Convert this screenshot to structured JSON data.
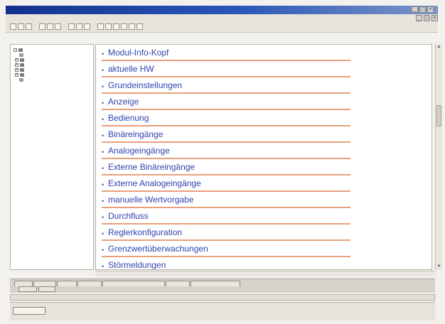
{
  "window": {
    "title": "",
    "controls": [
      "_",
      "□",
      "×"
    ]
  },
  "menu": {
    "items": [
      "",
      "",
      "",
      "",
      ""
    ]
  },
  "toolbar": {
    "link_label": ""
  },
  "tree": {
    "nodes": [
      "",
      "",
      "",
      "",
      "",
      "",
      "",
      ""
    ]
  },
  "main": {
    "sections": [
      {
        "label": "Modul-Info-Kopf"
      },
      {
        "label": "aktuelle HW"
      },
      {
        "label": "Grundeinstellungen"
      },
      {
        "label": "Anzeige"
      },
      {
        "label": "Bedienung"
      },
      {
        "label": "Binäreingänge"
      },
      {
        "label": "Analogeingänge"
      },
      {
        "label": "Externe Binäreingänge"
      },
      {
        "label": "Externe Analogeingänge"
      },
      {
        "label": "manuelle Wertvorgabe"
      },
      {
        "label": "Durchfluss"
      },
      {
        "label": "Reglerkonfiguration"
      },
      {
        "label": "Grenzwertüberwachungen"
      },
      {
        "label": "Störmeldungen"
      }
    ]
  },
  "tabs": {
    "top": [
      "",
      "",
      "",
      "",
      "",
      "",
      ""
    ],
    "bottom": [
      "",
      ""
    ]
  },
  "status": {
    "text": ""
  },
  "bottom_button": {
    "label": ""
  },
  "colors": {
    "title_start": "#12318f",
    "link_text": "#2f44b0",
    "divider": "#e8a07a"
  }
}
